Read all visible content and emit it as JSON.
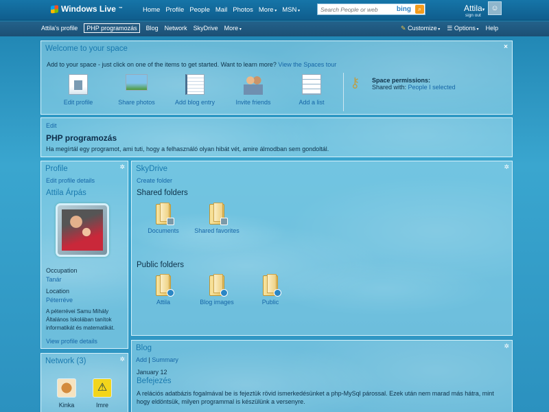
{
  "topbar": {
    "brand": "Windows Live",
    "brand_tm": "™",
    "nav": [
      "Home",
      "Profile",
      "People",
      "Mail",
      "Photos",
      "More",
      "MSN"
    ],
    "search_placeholder": "Search People or web",
    "search_logo": "bing",
    "user": "Attila",
    "signout": "sign out"
  },
  "subnav": {
    "items": [
      "Attila's profile",
      "PHP programozás",
      "Blog",
      "Network",
      "SkyDrive",
      "More"
    ],
    "active": 1,
    "right": [
      "Customize",
      "Options",
      "Help"
    ]
  },
  "welcome": {
    "title": "Welcome to your space",
    "intro": "Add to your space - just click on one of the items to get started. Want to learn more?",
    "tour_link": "View the Spaces tour",
    "tiles": [
      "Edit profile",
      "Share photos",
      "Add blog entry",
      "Invite friends",
      "Add a list"
    ],
    "permissions_title": "Space permissions:",
    "shared_with_label": "Shared with:",
    "shared_with_link": "People I selected"
  },
  "space": {
    "edit": "Edit",
    "title": "PHP programozás",
    "desc": "Ha megírtál egy programot, ami tuti, hogy a felhasználó olyan hibát vét, amire álmodban sem gondoltál."
  },
  "profile": {
    "title": "Profile",
    "edit": "Edit profile details",
    "name": "Attila Árpás",
    "occupation_label": "Occupation",
    "occupation": "Tanár",
    "location_label": "Location",
    "location": "Péterréve",
    "about": "A péterrévei Samu Mihály Általános Iskolában tanítok informatikát és matematikát.",
    "view": "View profile details"
  },
  "network": {
    "title": "Network (3)",
    "members": [
      "Kinka",
      "Imre"
    ]
  },
  "skydrive": {
    "title": "SkyDrive",
    "create": "Create folder",
    "shared_title": "Shared folders",
    "shared": [
      "Documents",
      "Shared favorites"
    ],
    "public_title": "Public folders",
    "public": [
      "Attila",
      "Blog images",
      "Public"
    ]
  },
  "blog": {
    "title": "Blog",
    "add": "Add",
    "sep": "|",
    "summary": "Summary",
    "date": "January 12",
    "entry_title": "Befejezés",
    "entry_text": "A relációs adatbázis fogalmával be is fejeztük rövid ismerkedésünket a php-MySql párossal. Ezek után nem marad más hátra, mint hogy eldöntsük, milyen programmal is készülünk a versenyre."
  }
}
